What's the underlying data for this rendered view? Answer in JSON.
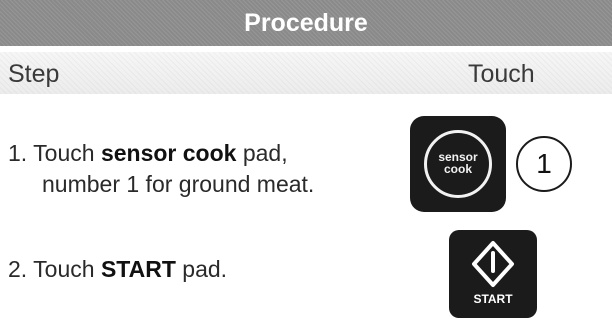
{
  "header": {
    "title": "Procedure"
  },
  "columns": {
    "step": "Step",
    "touch": "Touch"
  },
  "steps": [
    {
      "number": "1.",
      "pre": "Touch ",
      "bold": "sensor cook",
      "post": " pad,",
      "line2": "number 1 for ground meat."
    },
    {
      "number": "2.",
      "pre": "Touch ",
      "bold": "START",
      "post": " pad."
    }
  ],
  "pads": {
    "sensor_cook": {
      "line1": "sensor",
      "line2": "cook"
    },
    "number": "1",
    "start": {
      "label": "START"
    }
  }
}
